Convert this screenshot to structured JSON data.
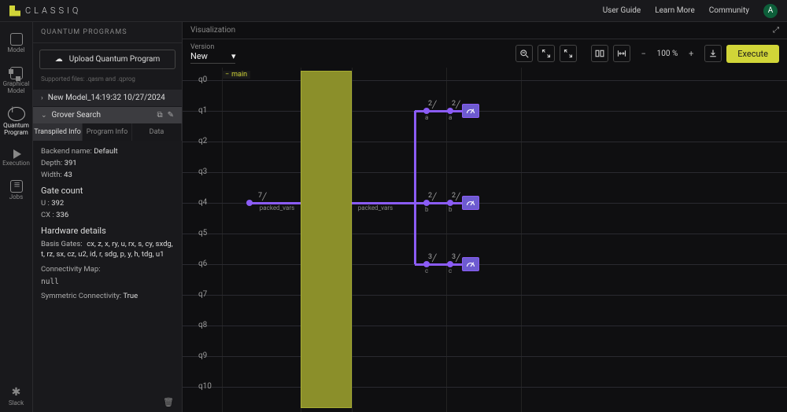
{
  "brand": "CLASSIQ",
  "topnav": {
    "user_guide": "User Guide",
    "learn_more": "Learn More",
    "community": "Community",
    "avatar_initial": "A"
  },
  "rail": {
    "model": "Model",
    "graphical_model": "Graphical\nModel",
    "quantum_program": "Quantum\nProgram",
    "execution": "Execution",
    "jobs": "Jobs",
    "slack": "Slack"
  },
  "sidebar": {
    "heading": "QUANTUM PROGRAMS",
    "upload": "Upload Quantum Program",
    "hint": "Supported files: .qasm and .qprog",
    "programs": [
      {
        "name": "New Model_14:19:32 10/27/2024",
        "expanded": false
      },
      {
        "name": "Grover Search",
        "expanded": true,
        "active": true
      }
    ],
    "tabs": {
      "transpiled": "Transpiled Info",
      "program": "Program Info",
      "data": "Data"
    },
    "transpiled": {
      "backend_label": "Backend name:",
      "backend": "Default",
      "depth_label": "Depth:",
      "depth": "391",
      "width_label": "Width:",
      "width": "43",
      "gate_count_heading": "Gate count",
      "u_label": "U :",
      "u": "392",
      "cx_label": "CX :",
      "cx": "336",
      "hardware_heading": "Hardware details",
      "basis_label": "Basis Gates:",
      "basis": "cx, z, x, ry, u, rx, s, cy, sxdg, t, rz, sx, cz, u2, id, r, sdg, p, y, h, tdg, u1",
      "conn_label": "Connectivity Map:",
      "conn": "null",
      "sym_label": "Symmetric Connectivity:",
      "sym": "True"
    }
  },
  "canvas": {
    "title": "Visualization",
    "version_label": "Version",
    "version": "New",
    "zoom": "100",
    "zoom_suffix": "%",
    "execute": "Execute"
  },
  "circuit": {
    "main_tag": "main",
    "qubits": [
      "q0",
      "q1",
      "q2",
      "q3",
      "q4",
      "q5",
      "q6",
      "q7",
      "q8",
      "q9",
      "q10"
    ],
    "bus_width": "7",
    "bus_label": "packed_vars",
    "branches": [
      {
        "q_index": 1,
        "width": "2",
        "name": "a"
      },
      {
        "q_index": 4,
        "width": "2",
        "name": "b"
      },
      {
        "q_index": 6,
        "width": "3",
        "name": "c"
      }
    ]
  }
}
